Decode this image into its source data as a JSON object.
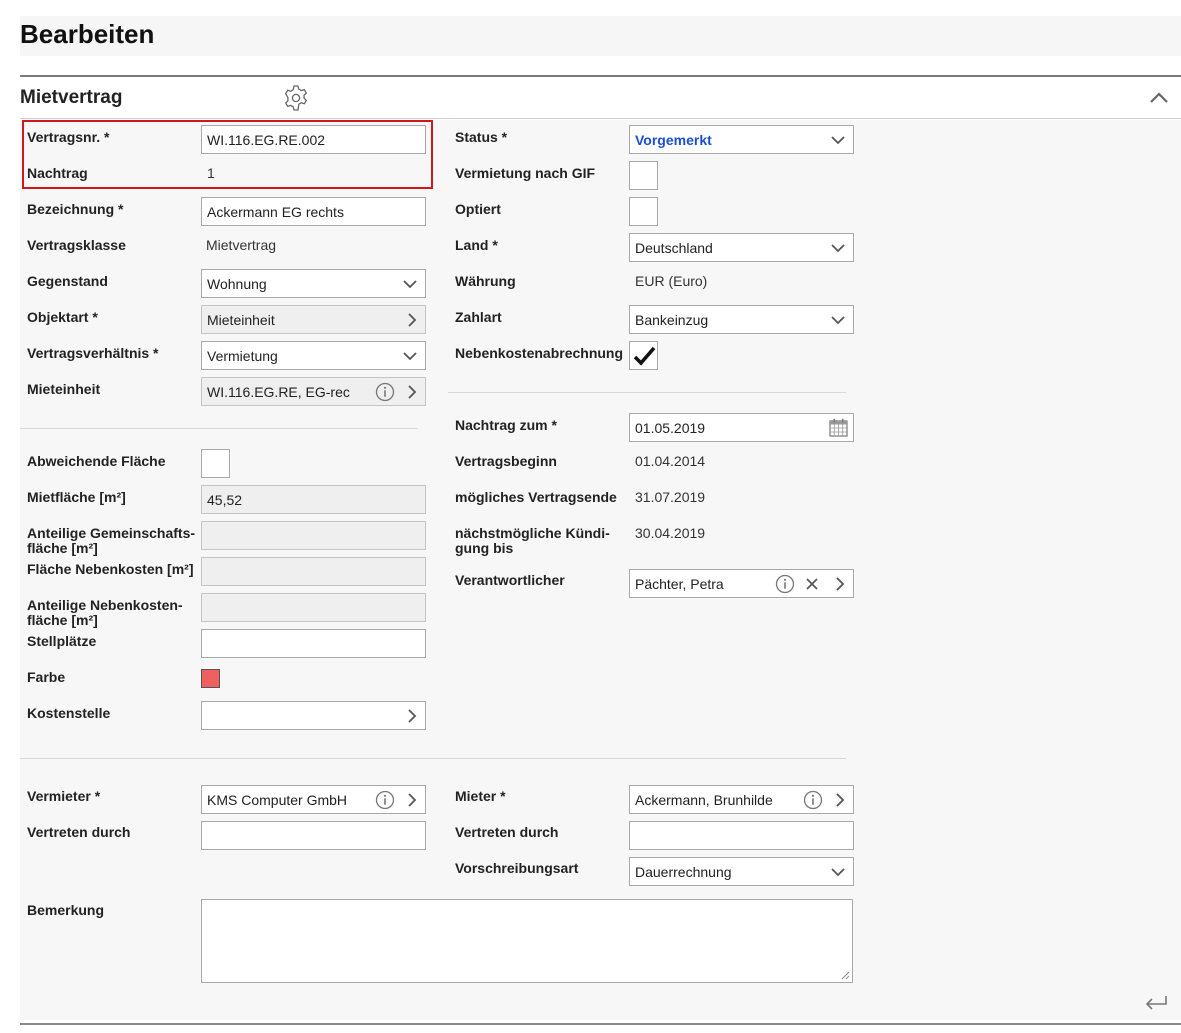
{
  "page": {
    "title": "Bearbeiten"
  },
  "section": {
    "title": "Mietvertrag"
  },
  "left": {
    "vertragsnr": {
      "label": "Vertragsnr. *",
      "value": "WI.116.EG.RE.002"
    },
    "nachtrag": {
      "label": "Nachtrag",
      "value": "1"
    },
    "bezeichnung": {
      "label": "Bezeichnung *",
      "value": "Ackermann EG rechts"
    },
    "vertragsklasse": {
      "label": "Vertragsklasse",
      "value": "Mietvertrag"
    },
    "gegenstand": {
      "label": "Gegenstand",
      "value": "Wohnung"
    },
    "objektart": {
      "label": "Objektart *",
      "value": "Mieteinheit"
    },
    "vertragsverhaeltnis": {
      "label": "Vertragsverhältnis *",
      "value": "Vermietung"
    },
    "mieteinheit": {
      "label": "Mieteinheit",
      "value": "WI.116.EG.RE, EG-rec"
    },
    "abweichende_flaeche": {
      "label": "Abweichende Fläche"
    },
    "mietflaeche": {
      "label": "Mietfläche [m²]",
      "value": "45,52"
    },
    "anteilige_gemeinschaftsflaeche": {
      "label": "Anteilige Gemeinschafts-fläche [m²]",
      "line1": "Anteilige Gemeinschafts-",
      "line2": "fläche [m²]"
    },
    "flaeche_nebenkosten": {
      "label": "Fläche Nebenkosten [m²]"
    },
    "anteilige_nebenkostenflaeche": {
      "label": "Anteilige Nebenkosten-fläche [m²]",
      "line1": "Anteilige Nebenkosten-",
      "line2": "fläche [m²]"
    },
    "stellplaetze": {
      "label": "Stellplätze"
    },
    "farbe": {
      "label": "Farbe",
      "color": "#f06060"
    },
    "kostenstelle": {
      "label": "Kostenstelle"
    }
  },
  "right": {
    "status": {
      "label": "Status *",
      "value": "Vorgemerkt"
    },
    "vermietung_gif": {
      "label": "Vermietung nach GIF",
      "checked": false
    },
    "optiert": {
      "label": "Optiert",
      "checked": false
    },
    "land": {
      "label": "Land *",
      "value": "Deutschland"
    },
    "waehrung": {
      "label": "Währung",
      "value": "EUR (Euro)"
    },
    "zahlart": {
      "label": "Zahlart",
      "value": "Bankeinzug"
    },
    "nebenkostenabrechnung": {
      "label": "Nebenkostenabrechnung",
      "checked": true
    },
    "nachtrag_zum": {
      "label": "Nachtrag zum *",
      "value": "01.05.2019"
    },
    "vertragsbeginn": {
      "label": "Vertragsbeginn",
      "value": "01.04.2014"
    },
    "moegliches_vertragsende": {
      "label": "mögliches Vertragsende",
      "value": "31.07.2019"
    },
    "naechstmoegliche_kuendigung": {
      "label": "nächstmögliche Kündi-gung bis",
      "line1": "nächstmögliche Kündi-",
      "line2": "gung bis",
      "value": "30.04.2019"
    },
    "verantwortlicher": {
      "label": "Verantwortlicher",
      "value": "Pächter, Petra"
    }
  },
  "parties": {
    "vermieter": {
      "label": "Vermieter *",
      "value": "KMS Computer GmbH"
    },
    "vermieter_vertreten": {
      "label": "Vertreten durch",
      "value": ""
    },
    "mieter": {
      "label": "Mieter *",
      "value": "Ackermann, Brunhilde"
    },
    "mieter_vertreten": {
      "label": "Vertreten durch",
      "value": ""
    },
    "vorschreibungsart": {
      "label": "Vorschreibungsart",
      "value": "Dauerrechnung"
    },
    "bemerkung": {
      "label": "Bemerkung",
      "value": ""
    }
  },
  "icons": {
    "gear": "gear-icon",
    "collapse": "chevron-up-icon",
    "dropdown": "chevron-down-icon",
    "navigate": "chevron-right-icon",
    "info": "info-icon",
    "clear": "close-icon",
    "calendar": "calendar-icon",
    "back": "back-arrow-icon"
  },
  "colors": {
    "highlight_border": "#d01818",
    "status_text": "#1b4fd1"
  }
}
